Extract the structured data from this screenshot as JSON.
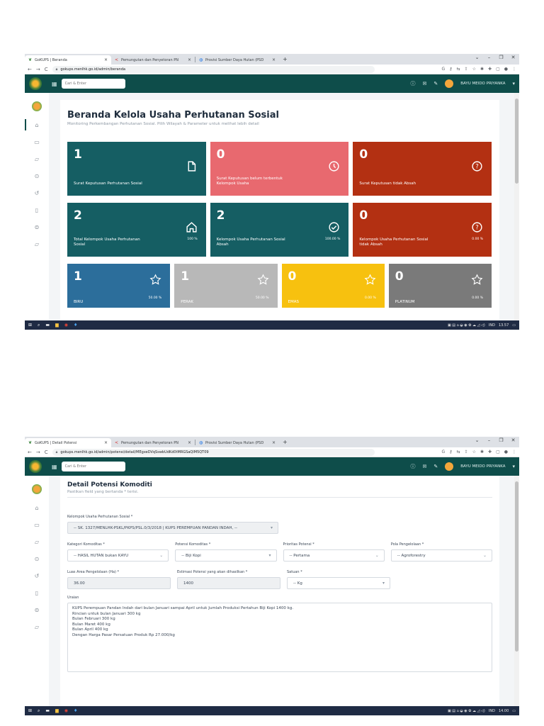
{
  "shot1": {
    "tabs": [
      {
        "title": "GoKUPS | Beranda"
      },
      {
        "title": "Pemungutan dan Penyetoran PN"
      },
      {
        "title": "Provisi Sumber Daya Hutan (PSD"
      }
    ],
    "url": "gokups.menlhk.go.id/admin/beranda",
    "search_placeholder": "Cari & Enter",
    "user": "BAYU MEIDO PRIYANKA",
    "page_title": "Beranda Kelola Usaha Perhutanan Sosial",
    "page_subtitle": "Monitoring Perkembangan Perhutanan Sosial. Pilih Wilayah & Parameter untuk melihat lebih detail",
    "cards_row1": [
      {
        "num": "1",
        "label": "Surat Keputusan Perhutanan Sosial",
        "icon": "file-icon",
        "color": "#155e63"
      },
      {
        "num": "0",
        "label": "Surat Keputusan belum terbentuk Kelompok Usaha",
        "icon": "clock-icon",
        "color": "#e8696f"
      },
      {
        "num": "0",
        "label": "Surat Keputusan tidak Absah",
        "icon": "question-icon",
        "color": "#b33012"
      }
    ],
    "cards_row2": [
      {
        "num": "2",
        "label": "Total Kelompok Usaha Perhutanan Sosial",
        "pct": "100 %",
        "icon": "home-icon",
        "color": "#155e63"
      },
      {
        "num": "2",
        "label": "Kelompok Usaha Perhutanan Sosial Absah",
        "pct": "100.00 %",
        "icon": "check-icon",
        "color": "#155e63"
      },
      {
        "num": "0",
        "label": "Kelompok Usaha Perhutanan Sosial tidak Absah",
        "pct": "0.00 %",
        "icon": "question-icon",
        "color": "#b33012"
      }
    ],
    "cards_row3": [
      {
        "num": "1",
        "label": "BIRU",
        "pct": "50.00 %",
        "icon": "star-icon",
        "color": "#2c6e9b"
      },
      {
        "num": "1",
        "label": "PERAK",
        "pct": "50.00 %",
        "icon": "star-icon",
        "color": "#b8b8b8"
      },
      {
        "num": "0",
        "label": "EMAS",
        "pct": "0.00 %",
        "icon": "star-icon",
        "color": "#f7c10f"
      },
      {
        "num": "0",
        "label": "PLATINUM",
        "pct": "0.00 %",
        "icon": "star-icon",
        "color": "#7a7a7a"
      }
    ],
    "tray": {
      "lang": "IND",
      "time": "13.57"
    }
  },
  "shot2": {
    "tabs": [
      {
        "title": "GoKUPS | Detail Potensi"
      },
      {
        "title": "Pemungutan dan Penyetoran PN"
      },
      {
        "title": "Provisi Sumber Daya Hutan (PSD"
      }
    ],
    "url": "gokups.menlhk.go.id/admin/potensi/detail/MEgxeDVqSswbUdKd0tMRGSaQlM5QT09",
    "search_placeholder": "Cari & Enter",
    "user": "BAYU MEIDO PRIYANKA",
    "title": "Detail Potensi Komoditi",
    "subtitle": "Pastikan field yang bertanda * terisi.",
    "kelompok_label": "Kelompok Usaha Perhutanan Sosial *",
    "kelompok_value": "-- SK. 1327/MENLHK-PSKL/PKPS/PSL.0/3/2018 | KUPS PEREMPUAN PANDAN INDAH, --",
    "kategori_label": "Kategori Komoditas *",
    "kategori_value": "-- HASIL HUTAN bukan KAYU",
    "potensi_label": "Potensi Komoditas *",
    "potensi_value": "-- Biji Kopi",
    "prioritas_label": "Prioritas Potensi *",
    "prioritas_value": "-- Pertama",
    "pola_label": "Pola Pengelolaan *",
    "pola_value": "-- Agroforestry",
    "luas_label": "Luas Area Pengelolaan (Ha) *",
    "luas_value": "36.00",
    "estimasi_label": "Estimasi Potensi yang akan dihasilkan *",
    "estimasi_value": "1400",
    "satuan_label": "Satuan *",
    "satuan_value": "-- Kg",
    "uraian_label": "Uraian",
    "uraian_lines": [
      "KUPS Perempuan Pandan Indah dari bulan Januari sampai April untuk Jumlah Produksi Pertahun Biji Kopi 1400 kg.",
      "Rincian untuk bulan Januari 300 kg",
      "Bulan Februari 300 kg",
      "Bulan Maret 400 kg",
      "Bulan April 400 kg",
      "Dengan Harga Pasar Persatuan Produk Rp 27.000/kg"
    ],
    "tray": {
      "lang": "IND",
      "time": "14.00"
    }
  }
}
